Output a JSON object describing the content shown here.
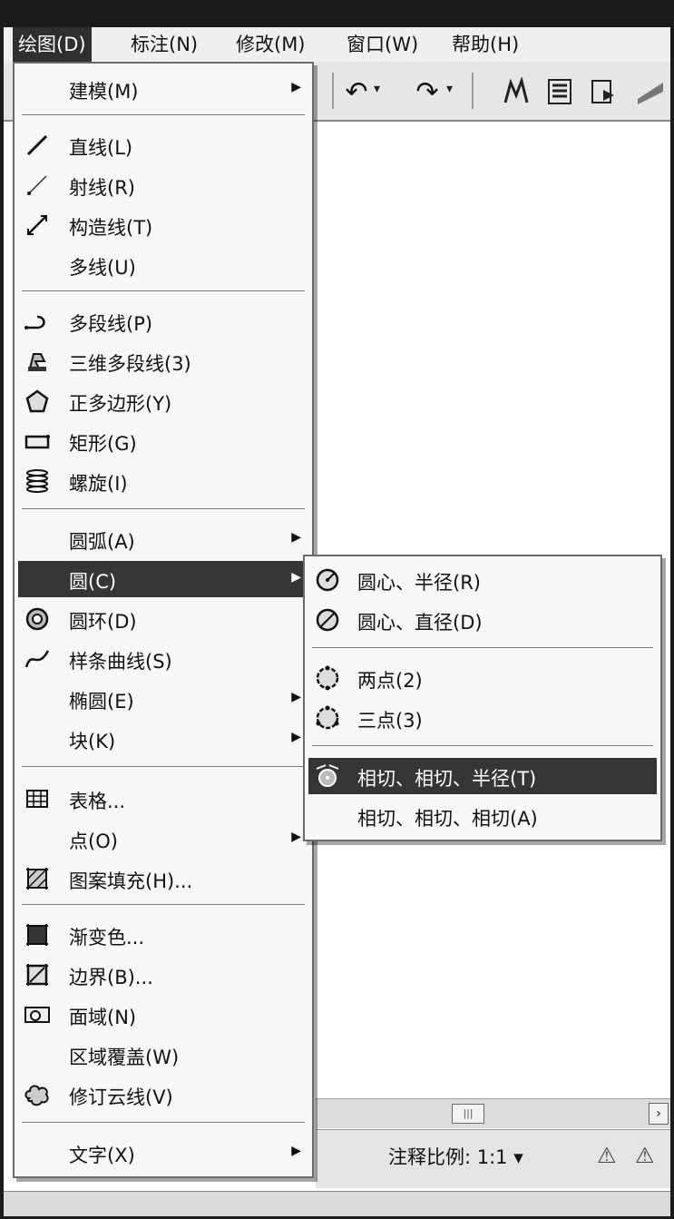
{
  "menubar": {
    "items": [
      "绘图(D)",
      "标注(N)",
      "修改(M)",
      "窗口(W)",
      "帮助(H)"
    ]
  },
  "draw_menu": {
    "items": [
      {
        "label": "建模(M)",
        "submenu": true
      },
      {
        "label": "直线(L)",
        "icon": "line-icon"
      },
      {
        "label": "射线(R)",
        "icon": "ray-icon"
      },
      {
        "label": "构造线(T)",
        "icon": "construction-line-icon"
      },
      {
        "label": "多线(U)"
      },
      {
        "label": "多段线(P)",
        "icon": "polyline-icon"
      },
      {
        "label": "三维多段线(3)",
        "icon": "3d-polyline-icon"
      },
      {
        "label": "正多边形(Y)",
        "icon": "polygon-icon"
      },
      {
        "label": "矩形(G)",
        "icon": "rectangle-icon"
      },
      {
        "label": "螺旋(I)",
        "icon": "helix-icon"
      },
      {
        "label": "圆弧(A)",
        "submenu": true
      },
      {
        "label": "圆(C)",
        "submenu": true,
        "highlighted": true
      },
      {
        "label": "圆环(D)",
        "icon": "donut-icon"
      },
      {
        "label": "样条曲线(S)",
        "icon": "spline-icon"
      },
      {
        "label": "椭圆(E)",
        "submenu": true
      },
      {
        "label": "块(K)",
        "submenu": true
      },
      {
        "label": "表格...",
        "icon": "table-icon"
      },
      {
        "label": "点(O)",
        "submenu": true
      },
      {
        "label": "图案填充(H)...",
        "icon": "hatch-icon"
      },
      {
        "label": "渐变色...",
        "icon": "gradient-icon"
      },
      {
        "label": "边界(B)...",
        "icon": "boundary-icon"
      },
      {
        "label": "面域(N)",
        "icon": "region-icon"
      },
      {
        "label": "区域覆盖(W)"
      },
      {
        "label": "修订云线(V)",
        "icon": "revcloud-icon"
      },
      {
        "label": "文字(X)",
        "submenu": true
      }
    ]
  },
  "circle_submenu": {
    "items": [
      {
        "label": "圆心、半径(R)",
        "icon": "circle-center-radius-icon"
      },
      {
        "label": "圆心、直径(D)",
        "icon": "circle-center-diameter-icon"
      },
      {
        "label": "两点(2)",
        "icon": "circle-2point-icon"
      },
      {
        "label": "三点(3)",
        "icon": "circle-3point-icon"
      },
      {
        "label": "相切、相切、半径(T)",
        "icon": "circle-ttr-icon",
        "highlighted": true
      },
      {
        "label": "相切、相切、相切(A)"
      }
    ]
  },
  "status": {
    "annotation_scale": "注释比例: 1:1 ▾"
  },
  "colors": {
    "highlight": "#353535",
    "menu_bg": "#f7f7f7",
    "frame": "#1b1b1b"
  }
}
